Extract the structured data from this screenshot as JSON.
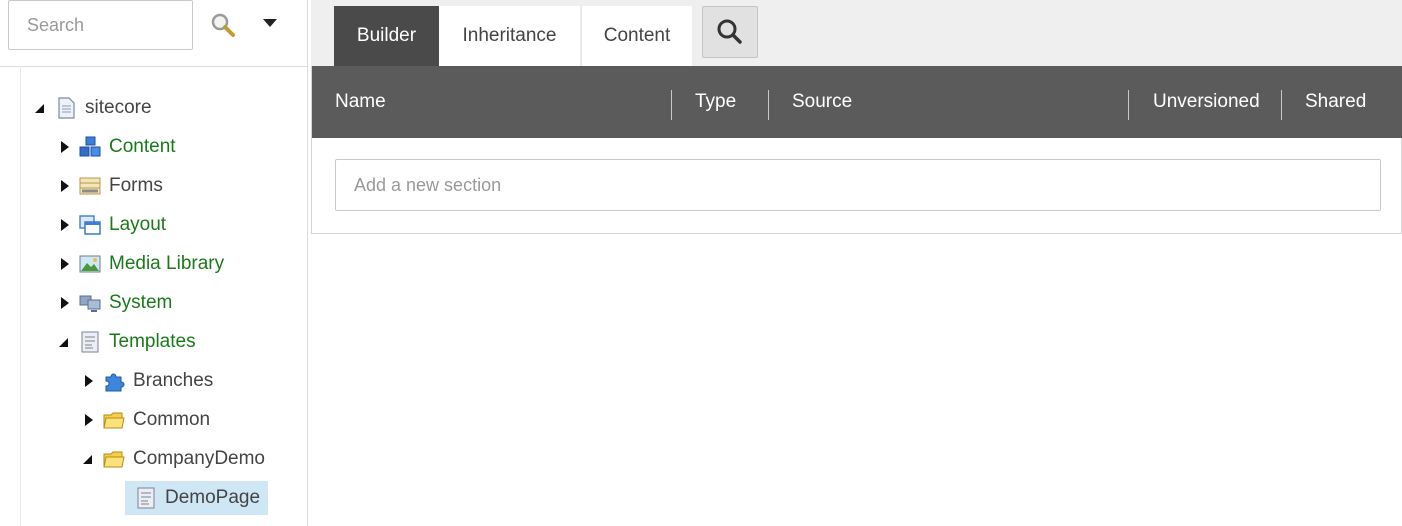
{
  "search": {
    "placeholder": "Search"
  },
  "tree": {
    "root": {
      "label": "sitecore"
    },
    "content": {
      "label": "Content"
    },
    "forms": {
      "label": "Forms"
    },
    "layout": {
      "label": "Layout"
    },
    "media_library": {
      "label": "Media Library"
    },
    "system": {
      "label": "System"
    },
    "templates": {
      "label": "Templates"
    },
    "branches": {
      "label": "Branches"
    },
    "common": {
      "label": "Common"
    },
    "company_demo": {
      "label": "CompanyDemo"
    },
    "demo_page": {
      "label": "DemoPage"
    }
  },
  "tabs": {
    "builder": "Builder",
    "inheritance": "Inheritance",
    "content": "Content"
  },
  "grid": {
    "columns": {
      "name": "Name",
      "type": "Type",
      "source": "Source",
      "unversioned": "Unversioned",
      "shared": "Shared"
    },
    "add_section_placeholder": "Add a new section"
  },
  "colors": {
    "active_tab": "#4a4a4a",
    "grid_header": "#5b5b5b",
    "tree_green_label": "#1a7a1a",
    "selected_row": "#cfe6f5"
  }
}
